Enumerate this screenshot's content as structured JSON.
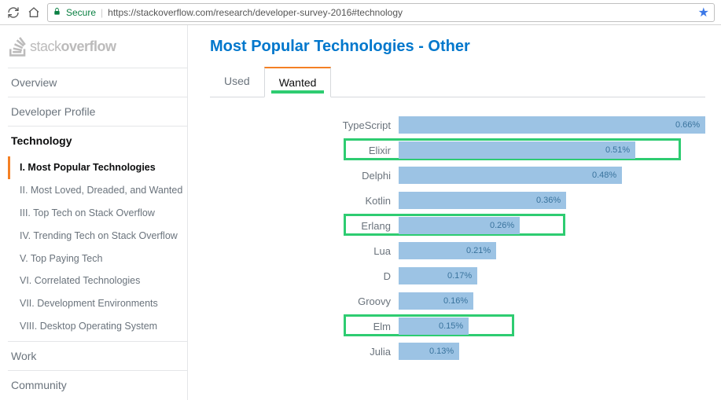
{
  "browser": {
    "secure_label": "Secure",
    "url": "https://stackoverflow.com/research/developer-survey-2016#technology"
  },
  "logo": {
    "text_normal": "stack",
    "text_bold": "overflow"
  },
  "nav": {
    "items": [
      {
        "label": "Overview",
        "active": false
      },
      {
        "label": "Developer Profile",
        "active": false
      },
      {
        "label": "Technology",
        "active": true,
        "sub": [
          {
            "label": "I. Most Popular Technologies",
            "active": true
          },
          {
            "label": "II. Most Loved, Dreaded, and Wanted",
            "active": false
          },
          {
            "label": "III. Top Tech on Stack Overflow",
            "active": false
          },
          {
            "label": "IV. Trending Tech on Stack Overflow",
            "active": false
          },
          {
            "label": "V. Top Paying Tech",
            "active": false
          },
          {
            "label": "VI. Correlated Technologies",
            "active": false
          },
          {
            "label": "VII. Development Environments",
            "active": false
          },
          {
            "label": "VIII. Desktop Operating System",
            "active": false
          }
        ]
      },
      {
        "label": "Work",
        "active": false
      },
      {
        "label": "Community",
        "active": false
      }
    ]
  },
  "main": {
    "title": "Most Popular Technologies - Other",
    "tabs": [
      {
        "label": "Used",
        "active": false
      },
      {
        "label": "Wanted",
        "active": true
      }
    ]
  },
  "chart_data": {
    "type": "bar",
    "orientation": "horizontal",
    "xlabel": "",
    "ylabel": "",
    "max_value": 0.66,
    "value_suffix": "%",
    "categories": [
      "TypeScript",
      "Elixir",
      "Delphi",
      "Kotlin",
      "Erlang",
      "Lua",
      "D",
      "Groovy",
      "Elm",
      "Julia"
    ],
    "values": [
      0.66,
      0.51,
      0.48,
      0.36,
      0.26,
      0.21,
      0.17,
      0.16,
      0.15,
      0.13
    ],
    "highlighted": [
      "Elixir",
      "Erlang",
      "Elm"
    ]
  }
}
